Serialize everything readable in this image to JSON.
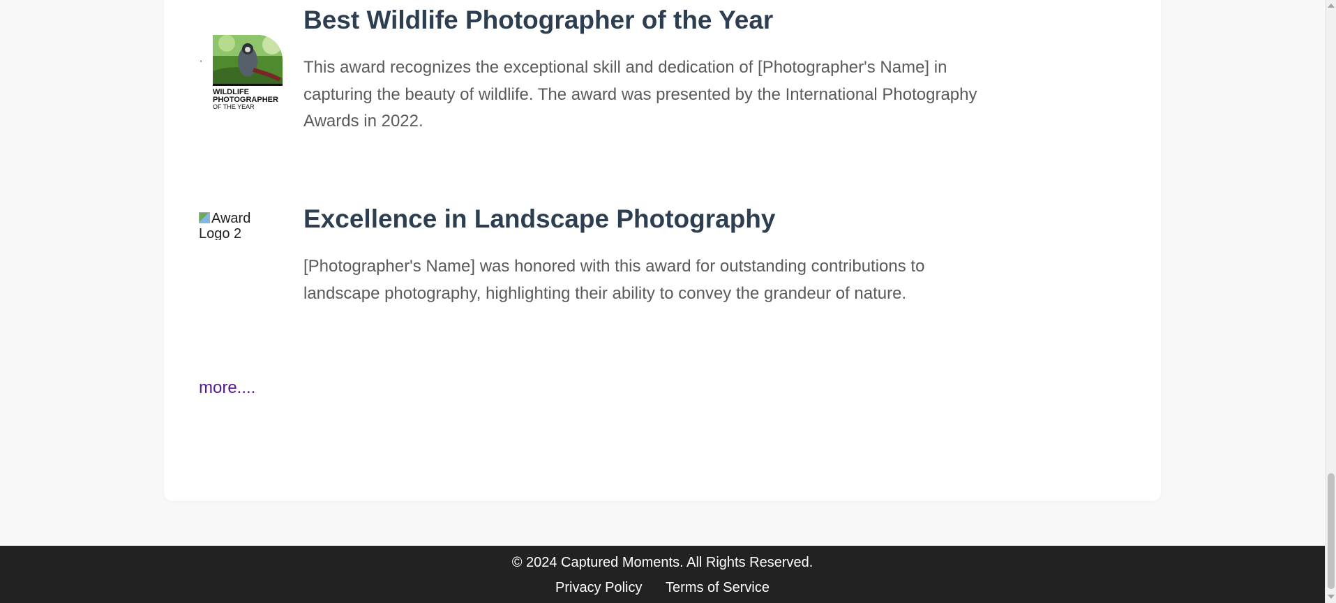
{
  "awards": [
    {
      "title": "Best Wildlife Photographer of the Year",
      "description": "This award recognizes the exceptional skill and dedication of [Photographer's Name] in capturing the beauty of wildlife. The award was presented by the International Photography Awards in 2022.",
      "logo": {
        "line1": "WILDLIFE",
        "line2": "PHOTOGRAPHER",
        "line3": "OF THE YEAR"
      }
    },
    {
      "title": "Excellence in Landscape Photography",
      "description": "[Photographer's Name] was honored with this award for outstanding contributions to landscape photography, highlighting their ability to convey the grandeur of nature.",
      "logo_alt": "Award Logo 2"
    }
  ],
  "more_link": "more....",
  "footer": {
    "copyright": "© 2024 Captured Moments. All Rights Reserved.",
    "links": [
      "Privacy Policy",
      "Terms of Service"
    ]
  },
  "colors": {
    "page_bg": "#f8f8f8",
    "card_bg": "#ffffff",
    "title": "#2c3e50",
    "body_text": "#5a5a5a",
    "link_visited": "#551a8b",
    "footer_bg": "#222222"
  }
}
